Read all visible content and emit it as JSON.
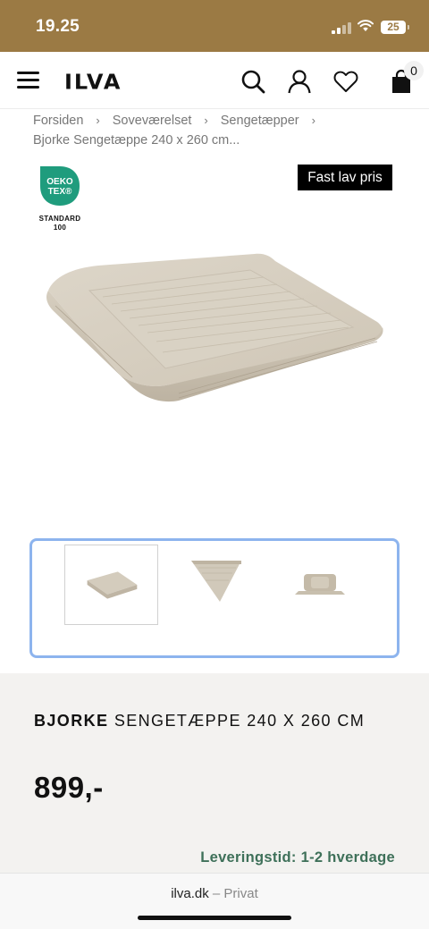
{
  "status_bar": {
    "time": "19.25",
    "battery": "25"
  },
  "header": {
    "logo": "ILVA",
    "cart_count": "0"
  },
  "breadcrumb": {
    "items": [
      "Forsiden",
      "Soveværelset",
      "Sengetæpper"
    ],
    "separator": "›",
    "current": "Bjorke Sengetæppe 240 x 260 cm..."
  },
  "badges": {
    "oeko_line1": "OEKO",
    "oeko_line2": "TEX®",
    "oeko_standard": "STANDARD",
    "oeko_number": "100",
    "price_tag": "Fast lav pris"
  },
  "product": {
    "brand": "BJORKE",
    "name": "SENGETÆPPE 240 X 260 CM",
    "price": "899,-",
    "delivery": "Leveringstid: 1-2 hverdage"
  },
  "browser": {
    "domain": "ilva.dk",
    "mode": "– Privat"
  },
  "colors": {
    "status_bar": "#9b7a44",
    "oeko_green": "#1f9c7d",
    "delivery_green": "#3e7059",
    "gallery_focus": "#8db4ee",
    "info_bg": "#f3f2f0"
  }
}
